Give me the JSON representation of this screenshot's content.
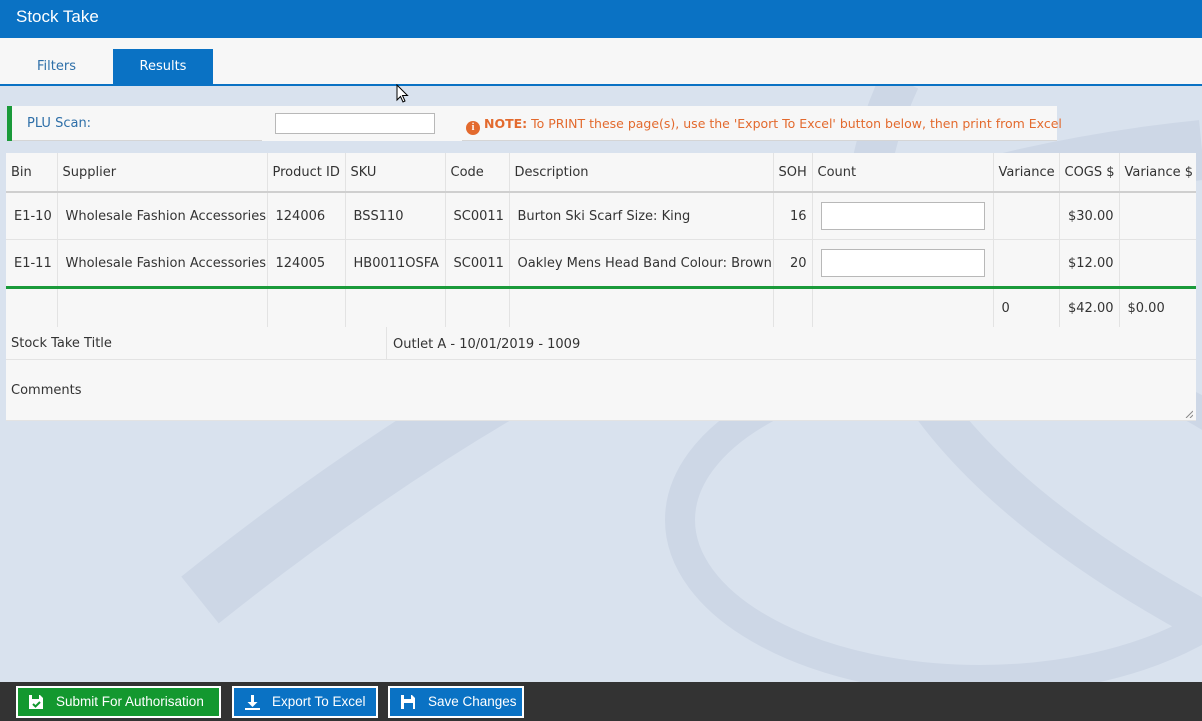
{
  "header": {
    "title": "Stock Take"
  },
  "tabs": [
    {
      "label": "Filters",
      "active": false
    },
    {
      "label": "Results",
      "active": true
    }
  ],
  "plu": {
    "label": "PLU Scan:",
    "value": "",
    "note_bold": "NOTE:",
    "note_text": " To PRINT these page(s), use the 'Export To Excel' button below, then print from Excel"
  },
  "table": {
    "columns": {
      "bin": "Bin",
      "supplier": "Supplier",
      "product_id": "Product ID",
      "sku": "SKU",
      "code": "Code",
      "description": "Description",
      "soh": "SOH",
      "count": "Count",
      "variance": "Variance",
      "cogs": "COGS $",
      "variance_dollar": "Variance $"
    },
    "rows": [
      {
        "bin": "E1-10",
        "supplier": "Wholesale Fashion Accessories",
        "product_id": "124006",
        "sku": "BSS110",
        "code": "SC0011",
        "description": "Burton Ski Scarf Size: King",
        "soh": "16",
        "count": "",
        "variance": "",
        "cogs": "$30.00",
        "variance_dollar": ""
      },
      {
        "bin": "E1-11",
        "supplier": "Wholesale Fashion Accessories",
        "product_id": "124005",
        "sku": "HB0011OSFA",
        "code": "SC0011",
        "description": "Oakley Mens Head Band Colour: Brown",
        "soh": "20",
        "count": "",
        "variance": "",
        "cogs": "$12.00",
        "variance_dollar": ""
      }
    ],
    "totals": {
      "variance": "0",
      "cogs": "$42.00",
      "variance_dollar": "$0.00"
    }
  },
  "stock_take": {
    "title_label": "Stock Take Title",
    "title_value": "Outlet A - 10/01/2019 - 1009"
  },
  "comments": {
    "label": "Comments",
    "value": ""
  },
  "actions": {
    "submit": "Submit For Authorisation",
    "export": "Export To Excel",
    "save": "Save Changes"
  },
  "colors": {
    "brand_blue": "#0a72c4",
    "accent_green": "#13982f",
    "note_orange": "#e36a2e",
    "bottom_bar": "#333333"
  },
  "icons": {
    "note": "info-circle-icon",
    "submit": "save-check-icon",
    "export": "download-icon",
    "save": "save-icon"
  }
}
